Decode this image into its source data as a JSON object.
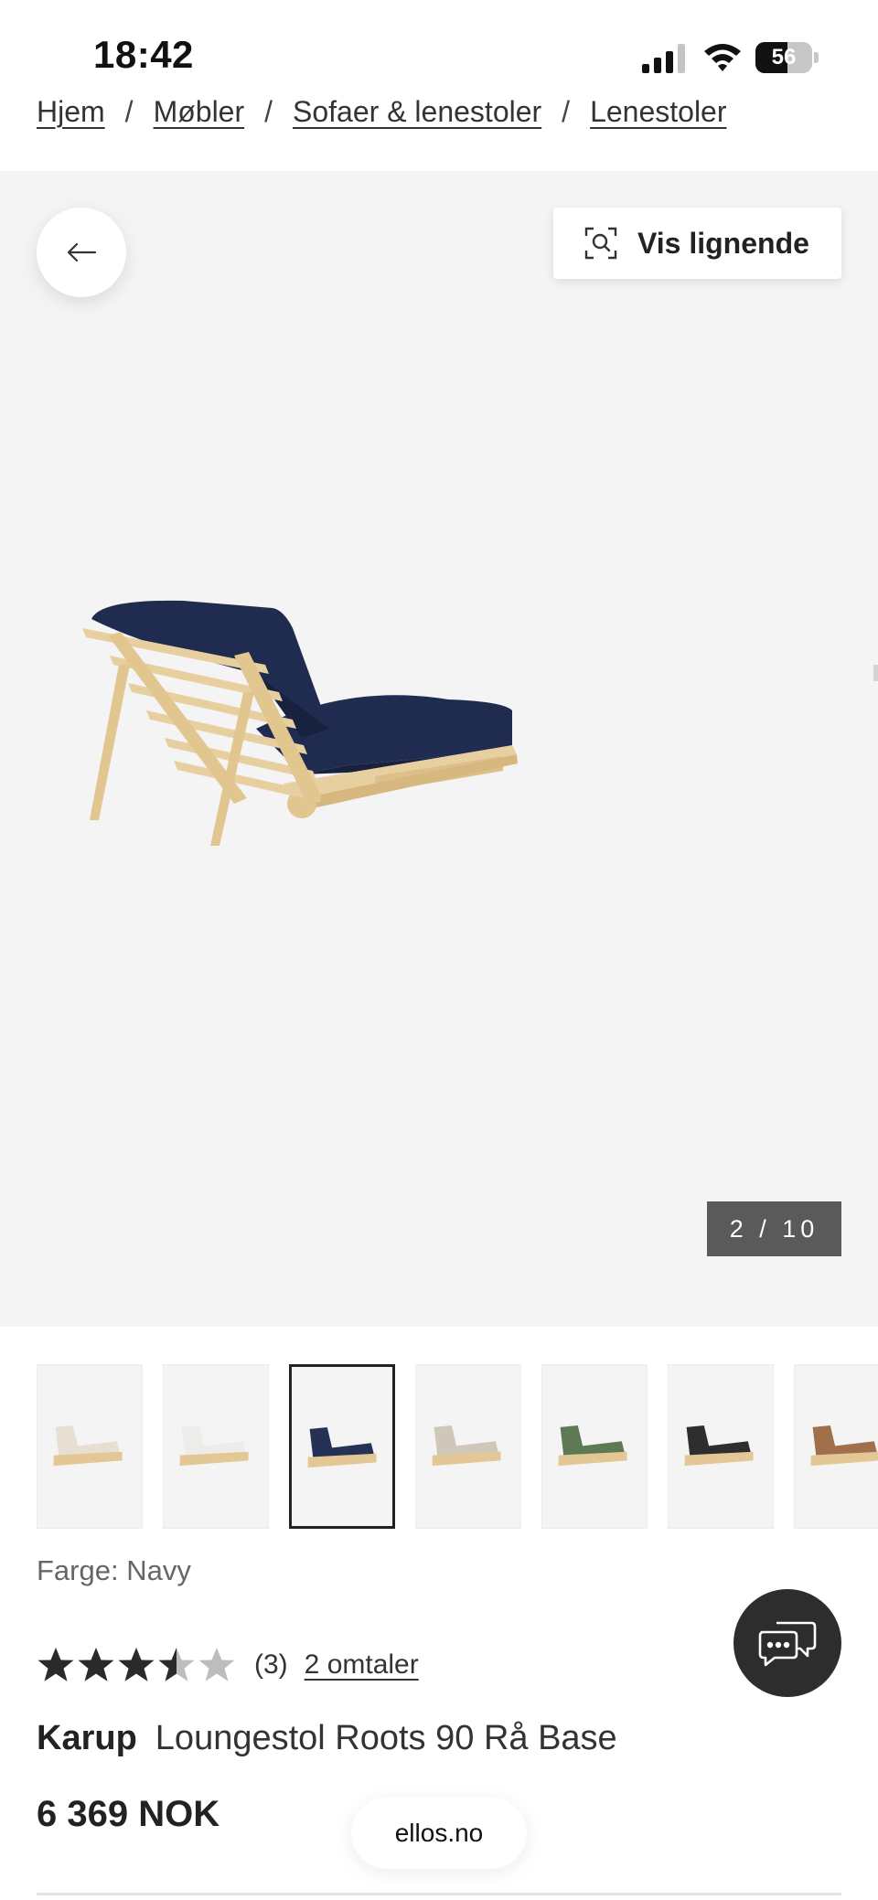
{
  "status_bar": {
    "time": "18:42",
    "battery_percent": "56",
    "battery_level": 0.56
  },
  "breadcrumb": {
    "items": [
      "Hjem",
      "Møbler",
      "Sofaer & lenestoler",
      "Lenestoler"
    ],
    "separator": "/"
  },
  "gallery": {
    "back_icon": "arrow-left-icon",
    "similar_icon": "visual-search-icon",
    "similar_label": "Vis lignende",
    "counter": "2 / 10",
    "current_image": 2,
    "total_images": 10,
    "background_color": "#f4f4f5"
  },
  "thumbnails": [
    {
      "color": "#e6dfd2",
      "selected": false
    },
    {
      "color": "#eeece8",
      "selected": false
    },
    {
      "color": "#263255",
      "selected": true
    },
    {
      "color": "#cfc8ba",
      "selected": false
    },
    {
      "color": "#5d7a55",
      "selected": false
    },
    {
      "color": "#2e2e2e",
      "selected": false
    },
    {
      "color": "#a0704c",
      "selected": false
    }
  ],
  "product": {
    "color_label": "Farge: Navy",
    "rating": 3.5,
    "rating_max": 5,
    "rating_count": "(3)",
    "reviews_link": "2 omtaler",
    "brand": "Karup",
    "name": "Loungestol Roots 90 Rå Base",
    "price": "6 369 NOK",
    "mattress_color": "#1f2b4f",
    "wood_color": "#e8cf9f"
  },
  "chat": {
    "icon": "chat-bubble-icon"
  },
  "browser": {
    "domain": "ellos.no"
  }
}
